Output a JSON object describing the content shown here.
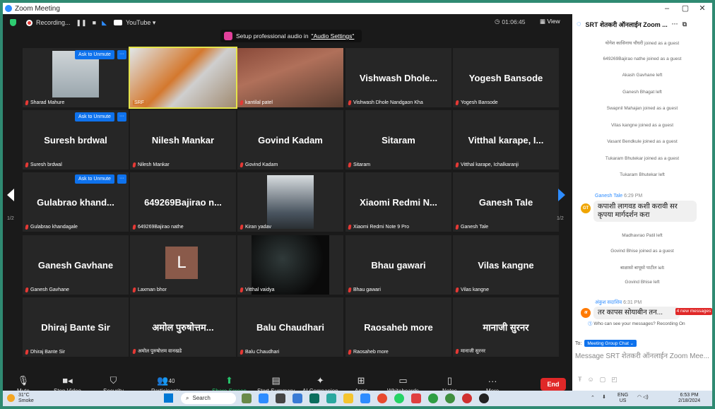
{
  "window": {
    "title": "Zoom Meeting",
    "minimize": "–",
    "maximize": "▢",
    "close": "✕"
  },
  "topbar": {
    "recording_label": "Recording...",
    "pause_icon": "❚❚",
    "stop_icon": "■",
    "stream_label": "YouTube ▾",
    "audio_tip_prefix": "Setup professional audio in",
    "audio_tip_link": "\"Audio Settings\"",
    "timer": "01:06:45",
    "view_label": "View"
  },
  "tiles": [
    {
      "name": "",
      "label": "Sharad Mahure",
      "unmute": "Ask to Unmute"
    },
    {
      "name": "",
      "label": "SRF"
    },
    {
      "name": "",
      "label": "kantilal patel"
    },
    {
      "name": "Vishwash Dhole...",
      "label": "Vishwash Dhole Nandgaon Kha"
    },
    {
      "name": "Yogesh Bansode",
      "label": "Yogesh Bansode"
    },
    {
      "name": "Suresh brdwal",
      "label": "Suresh brdwal",
      "unmute": "Ask to Unmute"
    },
    {
      "name": "Nilesh Mankar",
      "label": "Nilesh Mankar"
    },
    {
      "name": "Govind Kadam",
      "label": "Govind Kadam"
    },
    {
      "name": "Sitaram",
      "label": "Sitaram"
    },
    {
      "name": "Vitthal karape, I...",
      "label": "Vitthal karape, Ichalkaranji"
    },
    {
      "name": "Gulabrao khand...",
      "label": "Gulabrao khandagale",
      "unmute": "Ask to Unmute"
    },
    {
      "name": "649269Bajirao n...",
      "label": "649269Bajirao nathe"
    },
    {
      "name": "",
      "label": "Kiran yadav"
    },
    {
      "name": "Xiaomi Redmi N...",
      "label": "Xiaomi Redmi Note 9 Pro"
    },
    {
      "name": "Ganesh Tale",
      "label": "Ganesh Tale"
    },
    {
      "name": "Ganesh Gavhane",
      "label": "Ganesh Gavhane"
    },
    {
      "name": "L",
      "label": "Laxman bhor"
    },
    {
      "name": "",
      "label": "Vitthal vaidya"
    },
    {
      "name": "Bhau gawari",
      "label": "Bhau gawari"
    },
    {
      "name": "Vilas kangne",
      "label": "Vilas kangne"
    },
    {
      "name": "Dhiraj Bante Sir",
      "label": "Dhiraj Bante Sir"
    },
    {
      "name": "अमोल पुरुषोत्तम...",
      "label": "अमोल पुरुषोत्तम वानखडे"
    },
    {
      "name": "Balu Chaudhari",
      "label": "Balu Chaudhari"
    },
    {
      "name": "Raosaheb more",
      "label": "Raosaheb more"
    },
    {
      "name": "मानाजी सुरनर",
      "label": "मानाजी सुरनर"
    }
  ],
  "more_icon": "···",
  "pager": {
    "left": "1/2",
    "right": "1/2"
  },
  "toolbar": {
    "mute": "Mute",
    "stop_video": "Stop Video",
    "security": "Security",
    "participants": "Participants",
    "participants_count": "40",
    "share_screen": "Share Screen",
    "start_summary": "Start Summary",
    "ai_companion": "AI Companion",
    "apps": "Apps",
    "whiteboards": "Whiteboards",
    "notes": "Notes",
    "more": "More",
    "end": "End"
  },
  "chat": {
    "title": "SRT शेतकरी ऑनलाईन Zoom ...",
    "header_more": "···",
    "header_popout": "⧉",
    "system": [
      "योगेश कासिनाथ चौधरी joined as a guest",
      "649269Bajirao nathe joined as a guest",
      "Akash Gavhane left",
      "Ganesh Bhagat left",
      "Swapnil Mahajan joined as a guest",
      "Vilas kangne joined as a guest",
      "Vasant Bendkule joined as a guest",
      "Tukaram Bhutekar joined as a guest",
      "Tukaram Bhutekar left"
    ],
    "message1": {
      "initials": "GT",
      "name": "Ganesh Tale",
      "time": "6:29 PM",
      "text": "कपाशी लागवड कशी करावी सर कृपया मार्गदर्शन करा"
    },
    "system2": [
      "Madhavrao Patil left",
      "Govind Bhise joined as a guest",
      "बाळासो बापूसो पाटील left",
      "Govind Bhise left"
    ],
    "message2": {
      "initials": "अ",
      "name": "अंकुश सदाशिव",
      "time": "6:31 PM",
      "text": "तर कापस सोयाबीन तन..."
    },
    "new_messages": "4 new messages ↓",
    "recording_notice": "Who can see your messages? Recording On",
    "to_label": "To:",
    "to_chip": "Meeting Group Chat ⌄",
    "input_placeholder": "Message SRT शेतकरी ऑनलाईन Zoom Mee..."
  },
  "taskbar": {
    "temp": "31°C",
    "weather": "Smoke",
    "search": "Search",
    "lang1": "ENG",
    "lang2": "US",
    "time": "6:53 PM",
    "date": "2/18/2024"
  }
}
